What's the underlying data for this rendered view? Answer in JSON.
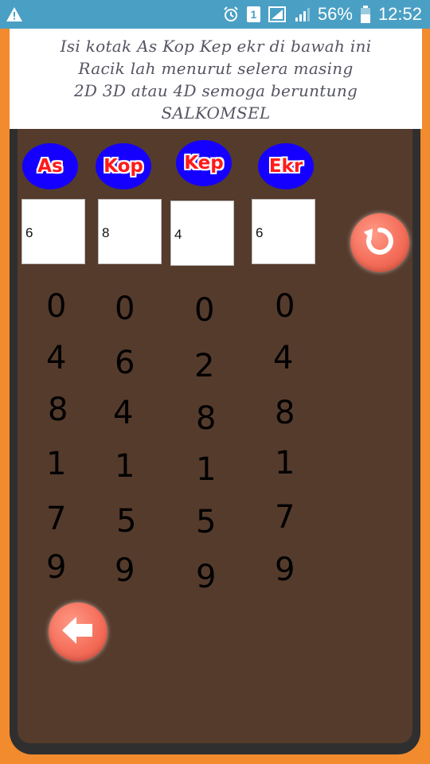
{
  "status_bar": {
    "sim_label": "1",
    "battery": "56%",
    "time": "12:52"
  },
  "header": {
    "lines": [
      "Isi kotak As Kop Kep ekr di bawah ini",
      "Racik lah menurut selera masing",
      "2D 3D atau 4D semoga beruntung",
      "SALKOMSEL"
    ]
  },
  "labels": [
    "As",
    "Kop",
    "Kep",
    "Ekr"
  ],
  "inputs": [
    "6",
    "8",
    "4",
    "6"
  ],
  "columns": [
    [
      "0",
      "4",
      "8",
      "1",
      "7",
      "9"
    ],
    [
      "0",
      "6",
      "4",
      "1",
      "5",
      "9"
    ],
    [
      "0",
      "2",
      "8",
      "1",
      "5",
      "9"
    ],
    [
      "0",
      "4",
      "8",
      "1",
      "7",
      "9"
    ]
  ],
  "icons": {
    "reset": "refresh-icon",
    "back": "arrow-left-icon"
  },
  "colors": {
    "frame": "#f28a2e",
    "background": "#553b2c",
    "badge": "#1500ff",
    "badge_text": "#ff1a1a",
    "button": "#f46e5a",
    "status_bar": "#4a9fc4"
  }
}
